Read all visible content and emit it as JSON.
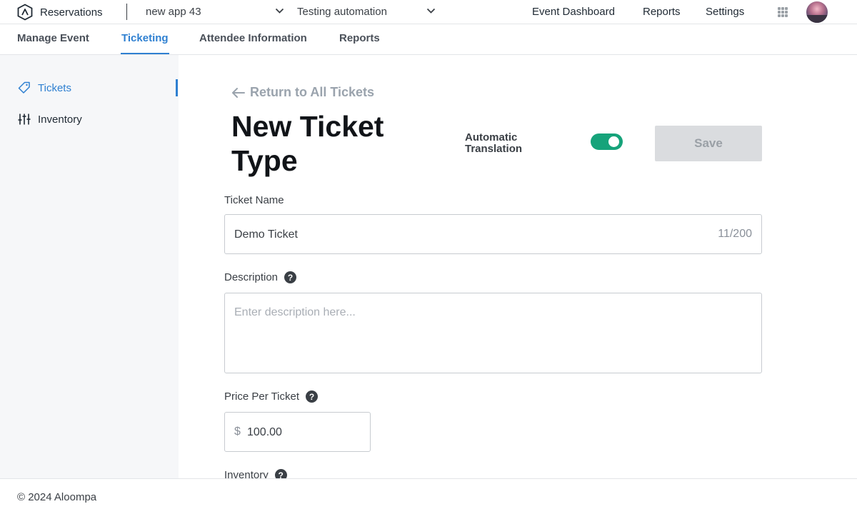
{
  "topbar": {
    "brand_name": "Reservations",
    "app_selector": "new app 43",
    "project_selector": "Testing automation",
    "nav": {
      "event_dashboard": "Event Dashboard",
      "reports": "Reports",
      "settings": "Settings"
    }
  },
  "subnav": {
    "tabs": [
      {
        "label": "Manage Event"
      },
      {
        "label": "Ticketing"
      },
      {
        "label": "Attendee Information"
      },
      {
        "label": "Reports"
      }
    ],
    "active_tab": "Ticketing"
  },
  "sidebar": {
    "items": [
      {
        "label": "Tickets",
        "icon": "tag-icon",
        "active": true
      },
      {
        "label": "Inventory",
        "icon": "sliders-icon",
        "active": false
      }
    ]
  },
  "main": {
    "back_link": "Return to All Tickets",
    "title": "New Ticket Type",
    "auto_translation_label": "Automatic Translation",
    "auto_translation_enabled": true,
    "save_label": "Save",
    "ticket_name": {
      "label": "Ticket Name",
      "value": "Demo Ticket",
      "counter": "11/200"
    },
    "description": {
      "label": "Description",
      "placeholder": "Enter description here..."
    },
    "price": {
      "label": "Price Per Ticket",
      "currency": "$",
      "value": "100.00"
    },
    "inventory": {
      "label": "Inventory"
    },
    "help_glyph": "?"
  },
  "footer": {
    "copyright": "© 2024 Aloompa"
  },
  "colors": {
    "accent": "#2f80d1",
    "toggle_on": "#16a37a",
    "sidebar_bg": "#f6f7f9"
  }
}
